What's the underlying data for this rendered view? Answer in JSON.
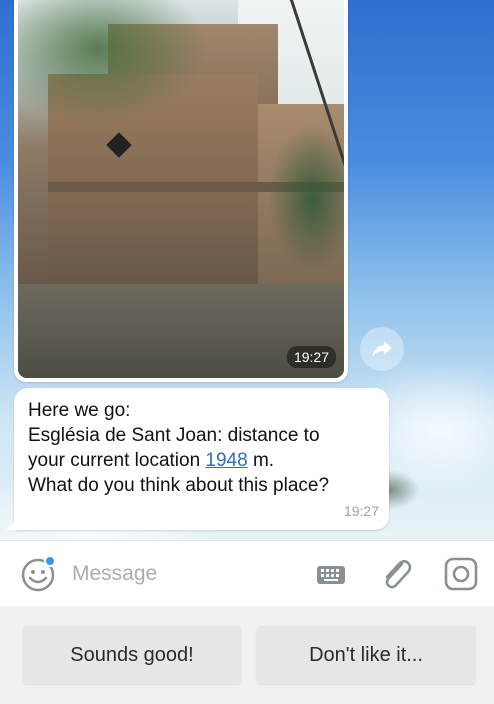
{
  "photo_message": {
    "time": "19:27"
  },
  "text_message": {
    "line1": "Here we go:",
    "line2": "Església de Sant Joan: distance to",
    "line3_prefix": "your current location ",
    "distance_link": "1948",
    "line3_suffix": " m.",
    "line4": "What do you think about this place?",
    "time": "19:27"
  },
  "composer": {
    "placeholder": "Message",
    "icons": [
      "emoji-icon",
      "keyboard-icon",
      "paperclip-icon",
      "camera-icon"
    ]
  },
  "reply_keyboard": {
    "buttons": [
      "Sounds good!",
      "Don't like it..."
    ]
  },
  "colors": {
    "accent": "#3e94e6",
    "link": "#2b6fb5"
  }
}
